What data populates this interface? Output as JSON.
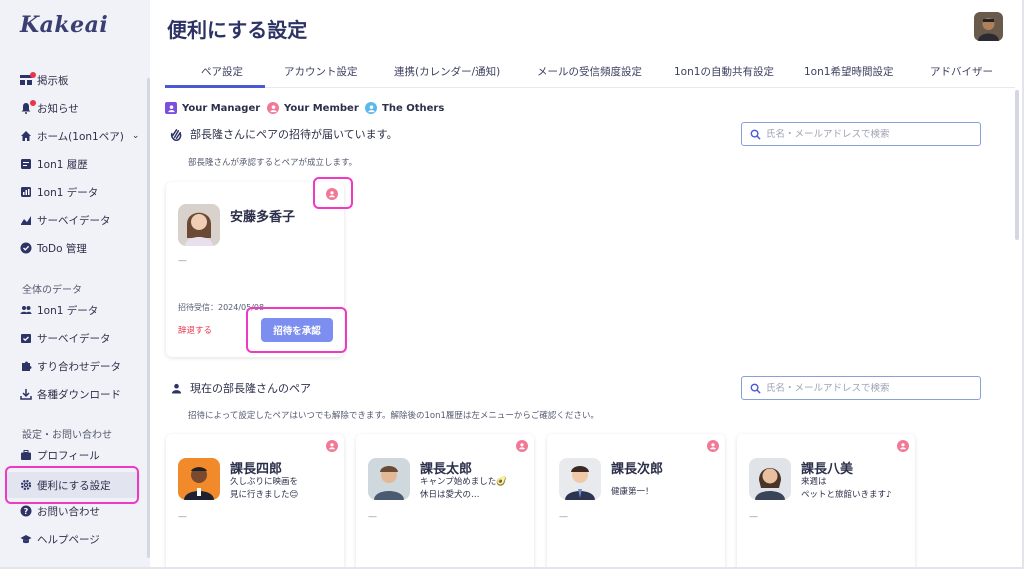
{
  "app": {
    "logo": "Kakeai"
  },
  "sidebar": {
    "top_items": [
      {
        "label": "掲示板",
        "icon": "board-icon",
        "badge": true
      },
      {
        "label": "お知らせ",
        "icon": "bell-icon",
        "badge": true
      },
      {
        "label": "ホーム(1on1ペア)",
        "icon": "home-icon"
      },
      {
        "label": "1on1 履歴",
        "icon": "history-icon"
      },
      {
        "label": "1on1 データ",
        "icon": "chart-icon"
      },
      {
        "label": "サーベイデータ",
        "icon": "survey-icon"
      },
      {
        "label": "ToDo 管理",
        "icon": "check-circle-icon"
      }
    ],
    "section_all_data": "全体のデータ",
    "all_items": [
      {
        "label": "1on1 データ",
        "icon": "people-icon"
      },
      {
        "label": "サーベイデータ",
        "icon": "calendar-check-icon"
      },
      {
        "label": "すり合わせデータ",
        "icon": "puzzle-icon"
      },
      {
        "label": "各種ダウンロード",
        "icon": "download-icon"
      }
    ],
    "section_settings": "設定・お問い合わせ",
    "settings_items": [
      {
        "label": "プロフィール",
        "icon": "briefcase-icon"
      },
      {
        "label": "便利にする設定",
        "icon": "gear-icon",
        "active": true
      },
      {
        "label": "お問い合わせ",
        "icon": "question-icon"
      },
      {
        "label": "ヘルプページ",
        "icon": "graduation-cap-icon"
      }
    ]
  },
  "header": {
    "title": "便利にする設定"
  },
  "tabs": [
    {
      "label": "ペア設定",
      "active": true
    },
    {
      "label": "アカウント設定"
    },
    {
      "label": "連携(カレンダー/通知)"
    },
    {
      "label": "メールの受信頻度設定"
    },
    {
      "label": "1on1の自動共有設定"
    },
    {
      "label": "1on1希望時間設定"
    },
    {
      "label": "アドバイザー"
    }
  ],
  "legend": [
    {
      "label": "Your Manager",
      "color": "#7a4ee0"
    },
    {
      "label": "Your Member",
      "color": "#f07a96"
    },
    {
      "label": "The Others",
      "color": "#5bb8e8"
    }
  ],
  "invites": {
    "heading": "部長隆さんにペアの招待が届いています。",
    "sub": "部長隆さんが承認するとペアが成立します。",
    "search_placeholder": "氏名・メールアドレスで検索",
    "card": {
      "name": "安藤多香子",
      "message": "—",
      "received": "招待受信：2024/05/08",
      "decline": "辞退する",
      "accept": "招待を承認"
    }
  },
  "pairs": {
    "heading": "現在の部長隆さんのペア",
    "sub": "招待によって設定したペアはいつでも解除できます。解除後の1on1履歴は左メニューからご確認ください。",
    "search_placeholder": "氏名・メールアドレスで検索",
    "cards": [
      {
        "name": "課長四郎",
        "message_l1": "久しぶりに映画を",
        "message_l2": "見に行きました😊",
        "dash": "—"
      },
      {
        "name": "課長太郎",
        "message_l1": "キャンプ始めました🥑",
        "message_l2": "休日は愛犬の…",
        "dash": "—"
      },
      {
        "name": "課長次郎",
        "message_l1": "健康第一！",
        "message_l2": "",
        "dash": "—"
      },
      {
        "name": "課長八美",
        "message_l1": "来週は",
        "message_l2": "ペットと旅館いきます♪",
        "dash": "—"
      }
    ]
  },
  "colors": {
    "accent": "#4a58d6",
    "highlight": "#ef38c4",
    "member": "#f07a96",
    "button": "#7c8ff0",
    "danger": "#e8354b"
  }
}
